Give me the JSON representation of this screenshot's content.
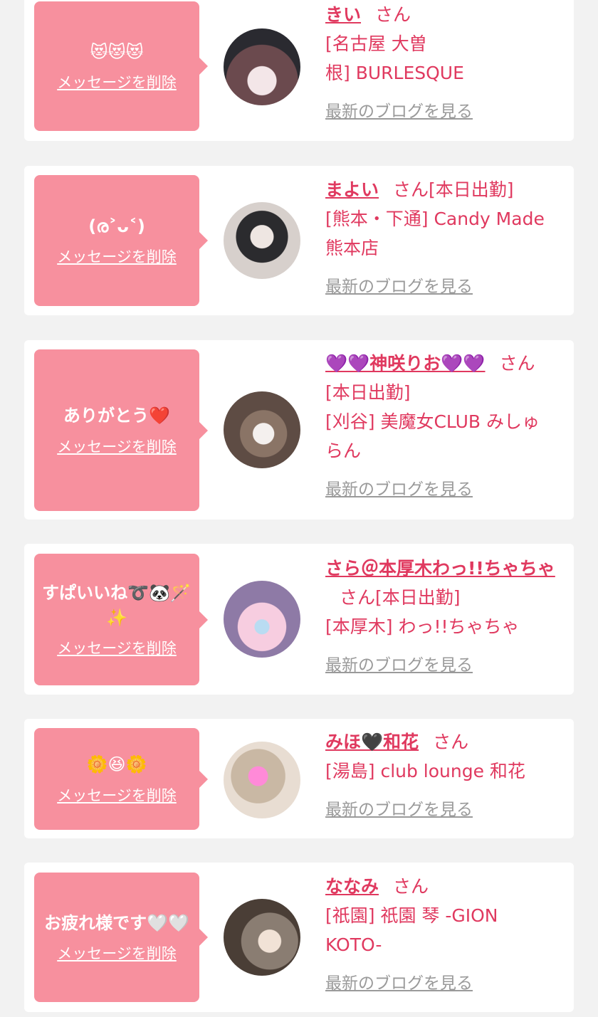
{
  "cards": [
    {
      "message": "😻😻😻",
      "delete_label": "メッセージを削除",
      "name": "きい",
      "honorific": "さん",
      "shop_lines": [
        "[名古屋 大曽",
        "根] BURLESQUE"
      ],
      "blog_label": "最新のブログを見る",
      "avatar_colors": [
        "#6b4a4e",
        "#f3e6e8",
        "#2a2a30"
      ]
    },
    {
      "message": "(ര˃ᴗ˂)",
      "delete_label": "メッセージを削除",
      "name": "まよい",
      "honorific": "さん[本日出勤]",
      "shop_lines": [
        "[熊本・下通] Candy Made",
        "熊本店"
      ],
      "blog_label": "最新のブログを見る",
      "avatar_colors": [
        "#d7d0cc",
        "#2b2b2e",
        "#eee6e2"
      ]
    },
    {
      "message": "ありがとう❤️",
      "delete_label": "メッセージを削除",
      "name": "💜💜神咲りお💜💜",
      "honorific": "さん",
      "shop_lines": [
        "[本日出勤]",
        "[刈谷] 美魔女CLUB みしゅ",
        "らん"
      ],
      "blog_label": "最新のブログを見る",
      "avatar_colors": [
        "#5e4c44",
        "#f4f0ee",
        "#8a7466"
      ]
    },
    {
      "message": "すぱいいね➰🐼🪄✨",
      "delete_label": "メッセージを削除",
      "name": "さら＠本厚木わっ!!ちゃちゃ",
      "honorific": "さん[本日出勤]",
      "shop_lines": [
        "[本厚木] わっ!!ちゃちゃ"
      ],
      "blog_label": "最新のブログを見る",
      "avatar_colors": [
        "#8e7aa6",
        "#f7cde0",
        "#b9dcf2"
      ]
    },
    {
      "message": "🌼😆🌼",
      "delete_label": "メッセージを削除",
      "name": "みほ🖤和花",
      "honorific": "さん",
      "shop_lines": [
        "[湯島] club lounge 和花"
      ],
      "blog_label": "最新のブログを見る",
      "avatar_colors": [
        "#c9b8a4",
        "#ff8ad8",
        "#e8ddd2"
      ]
    },
    {
      "message": "お疲れ様です🤍🤍",
      "delete_label": "メッセージを削除",
      "name": "ななみ",
      "honorific": "さん",
      "shop_lines": [
        "[祇園] 祇園 琴 -GION",
        "KOTO-"
      ],
      "blog_label": "最新のブログを見る",
      "avatar_colors": [
        "#8a7d72",
        "#f1e2d6",
        "#4a3e36"
      ]
    }
  ]
}
